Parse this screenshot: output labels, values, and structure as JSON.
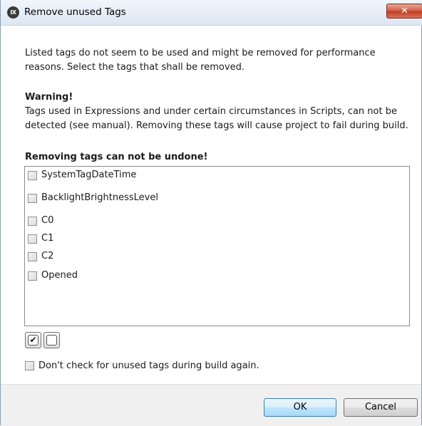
{
  "window": {
    "icon_text": "IX",
    "title": "Remove unused Tags",
    "close_symbol": "✕"
  },
  "description": "Listed tags do not seem to be used and might be removed for performance reasons. Select the tags that shall be removed.",
  "warning": {
    "title": "Warning!",
    "body": "Tags used in Expressions and under certain circumstances in Scripts, can not be detected (see manual). Removing these tags will cause project to fail during build.",
    "emphasis": "Removing tags can not be undone!"
  },
  "tags": [
    {
      "label": "SystemTagDateTime",
      "checked": false
    },
    {
      "label": "BacklightBrightnessLevel",
      "checked": false
    },
    {
      "label": "C0",
      "checked": false
    },
    {
      "label": "C1",
      "checked": false
    },
    {
      "label": "C2",
      "checked": false
    },
    {
      "label": "Opened",
      "checked": false
    }
  ],
  "selection_buttons": {
    "check_all_symbol": "✔",
    "check_all_icon": "check-all-icon",
    "uncheck_all_icon": "uncheck-all-icon"
  },
  "dont_check": {
    "label": "Don't check for unused tags during build again.",
    "checked": false
  },
  "buttons": {
    "ok": "OK",
    "cancel": "Cancel"
  }
}
